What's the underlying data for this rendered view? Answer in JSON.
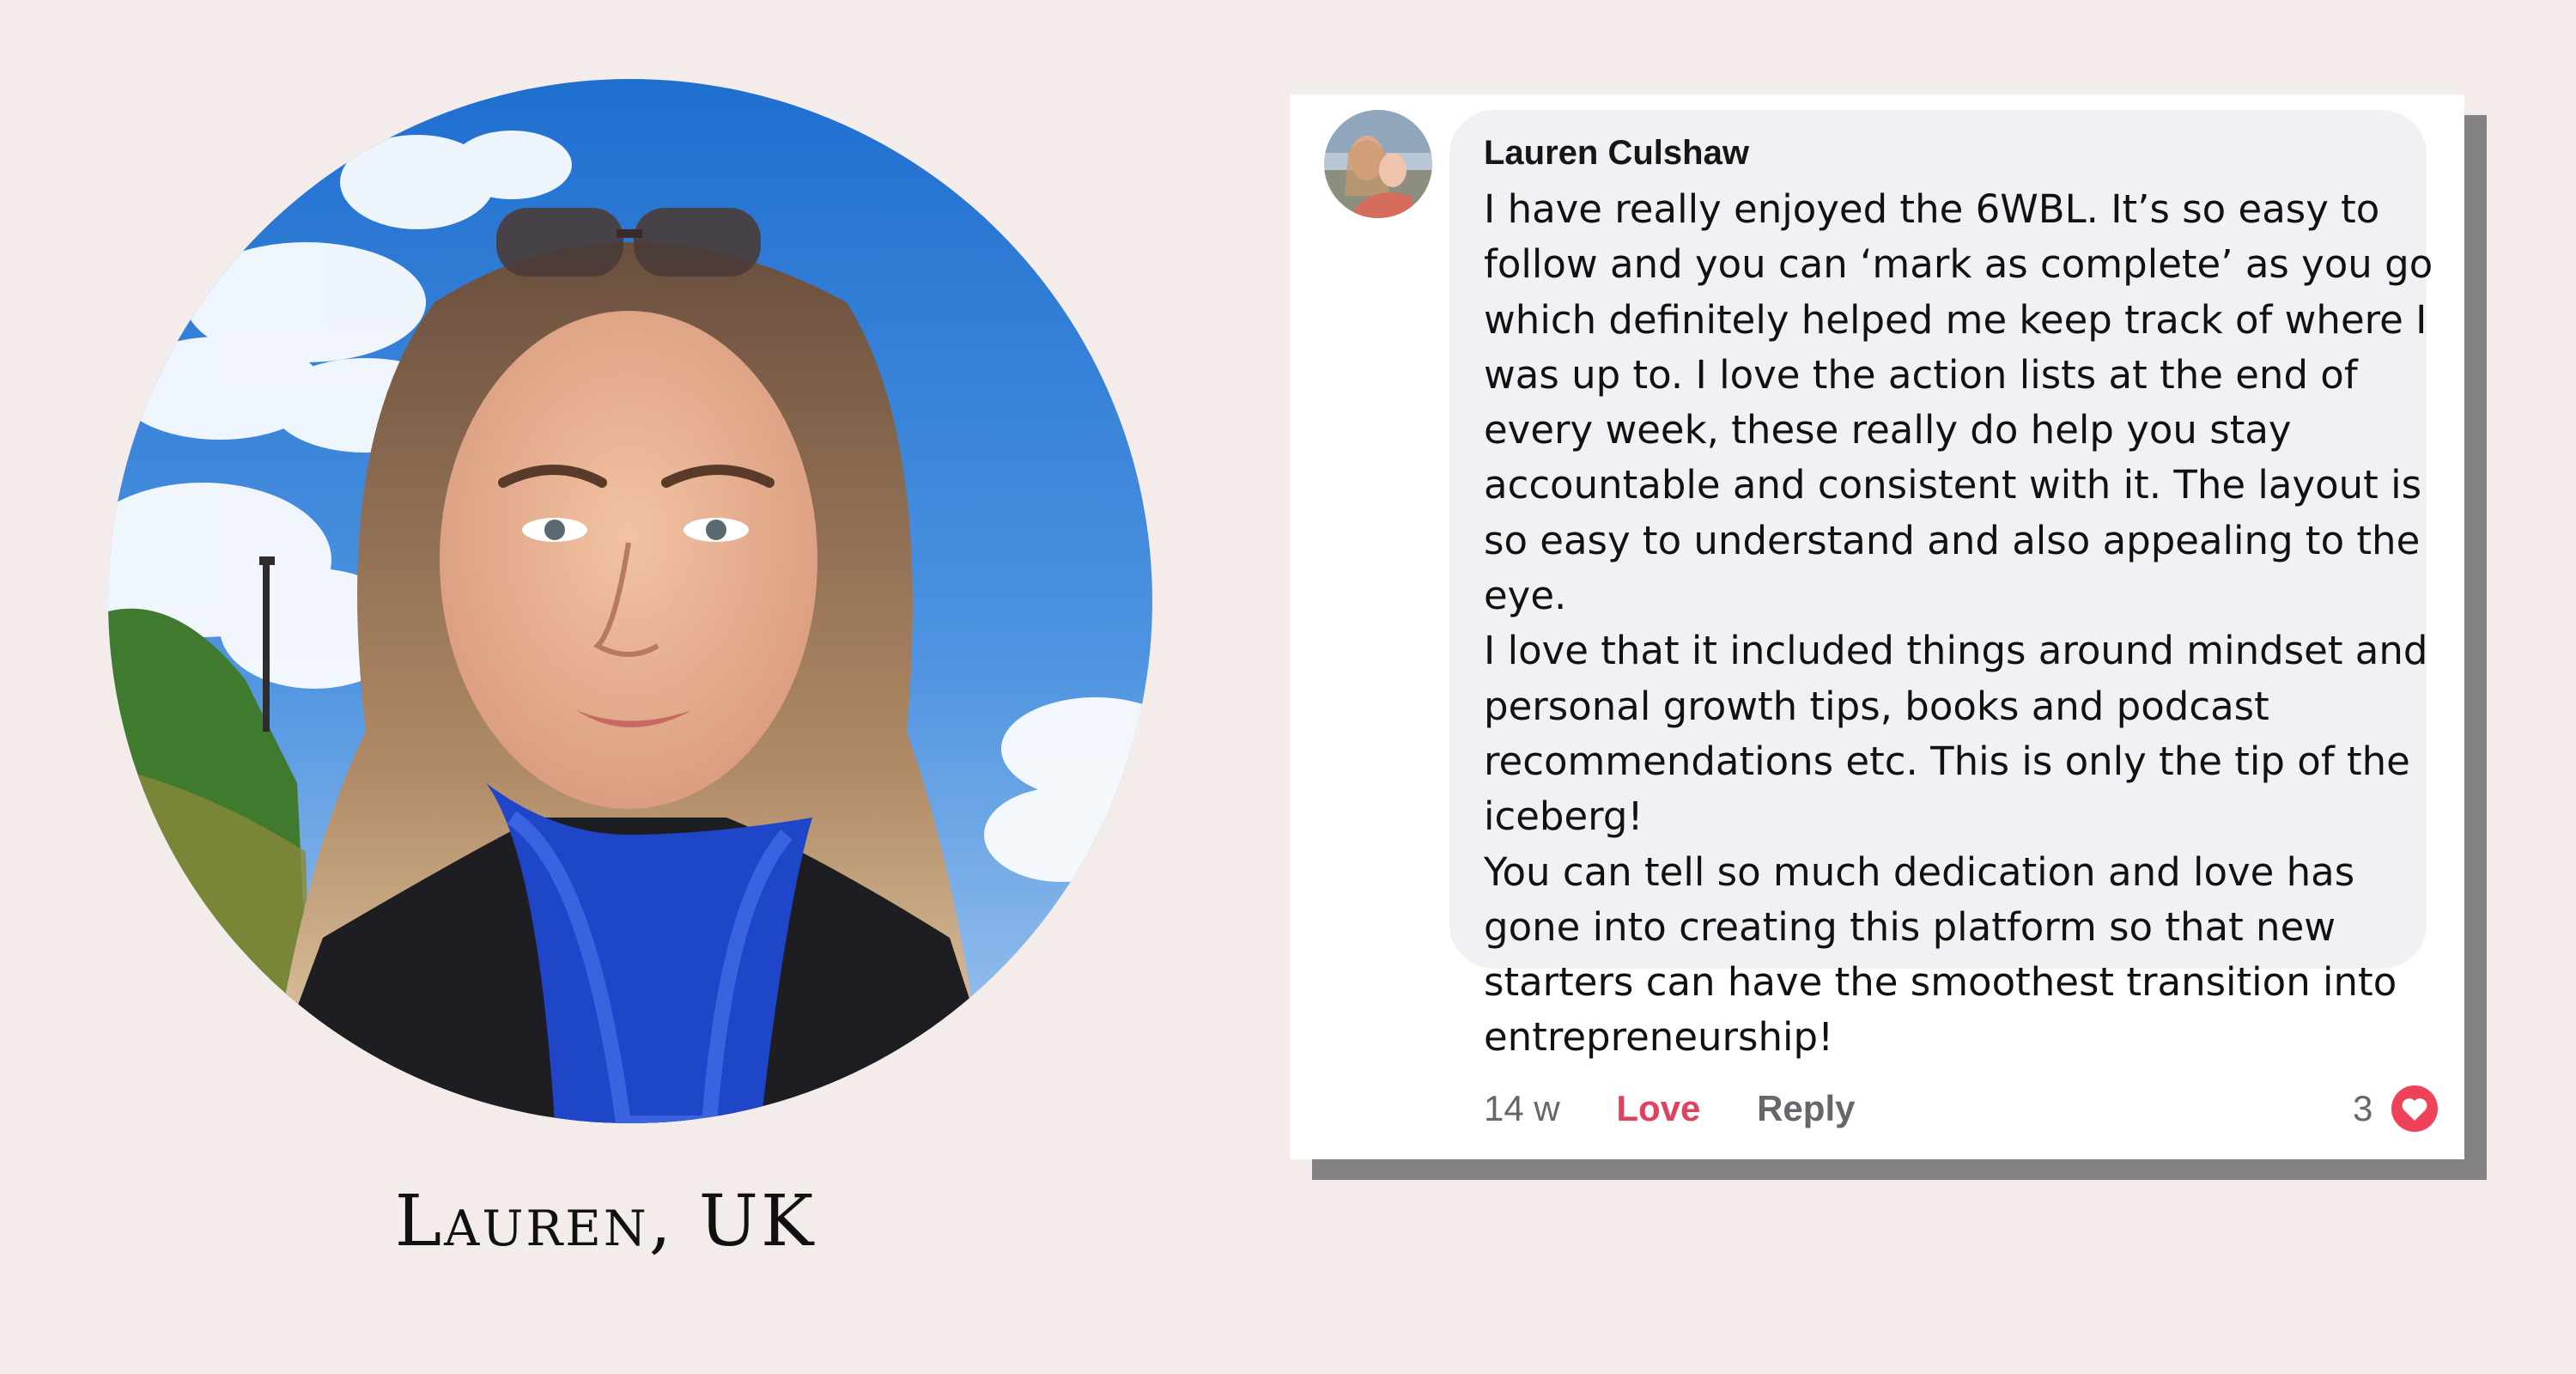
{
  "portrait": {
    "caption": "Lauren, UK"
  },
  "comment": {
    "author": "Lauren Culshaw",
    "lines": [
      "I have really enjoyed the 6WBL. It’s so easy to",
      "follow and you can ‘mark as complete’ as you go",
      "which definitely helped me keep track of where I",
      "was up to. I love the action lists at the end of",
      "every week, these really do help you stay",
      "accountable and consistent with it. The layout is",
      "so easy to understand and also appealing to the",
      "eye.",
      "I love that it included things around mindset and",
      "personal growth tips, books and podcast",
      "recommendations etc. This is only the tip of the",
      "iceberg!",
      "You can tell so much dedication and love has",
      "gone into creating this platform so that new",
      "starters can have the smoothest transition into",
      "entrepreneurship!"
    ],
    "age": "14 w",
    "love_label": "Love",
    "reply_label": "Reply",
    "reaction_count": "3",
    "reaction_icon": "heart-icon"
  },
  "colors": {
    "page_background": "#f3ecea",
    "bubble_background": "#f0f1f5",
    "love_accent": "#e0415e",
    "reaction_badge": "#ef4159",
    "muted_text": "#65676b"
  }
}
